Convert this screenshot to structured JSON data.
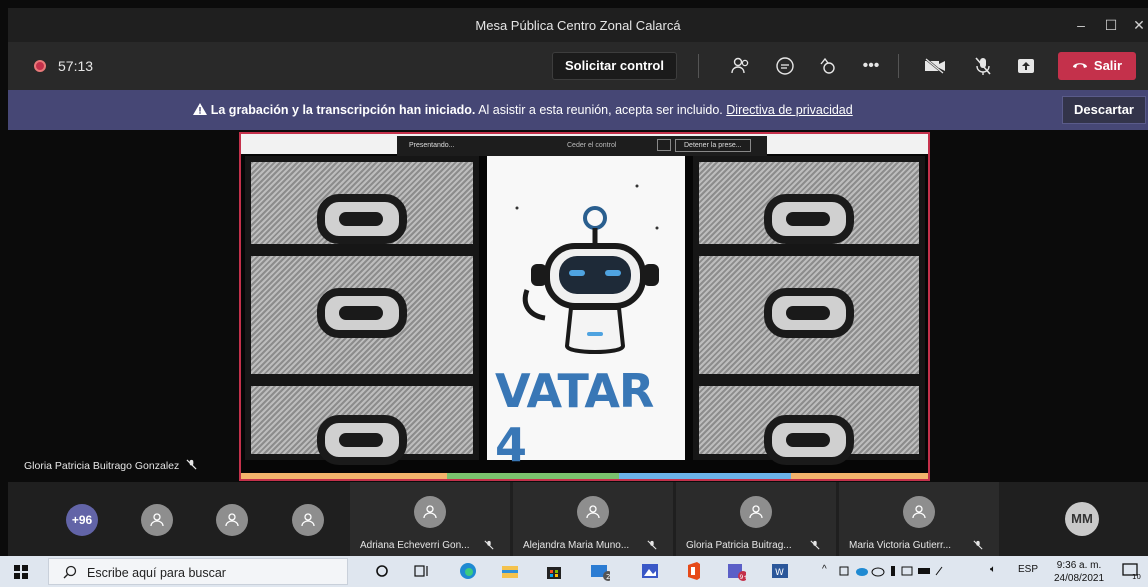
{
  "window": {
    "title": "Mesa Pública Centro Zonal Calarcá",
    "controls": [
      "minimize-icon",
      "maximize-icon",
      "close-icon"
    ]
  },
  "meeting_bar": {
    "timer": "57:13",
    "request_control_label": "Solicitar control",
    "icons": [
      "participants-icon",
      "chat-icon",
      "reactions-icon",
      "more-options-icon",
      "camera-off-icon",
      "mic-off-icon",
      "share-tray-icon"
    ],
    "leave_label": "Salir",
    "accent_leave": "#c4314b"
  },
  "banner": {
    "bold_text": "La grabación y la transcripción han iniciado.",
    "text": "Al asistir a esta reunión, acepta ser incluido.",
    "link": "Directiva de privacidad",
    "dismiss_label": "Descartar",
    "color": "#464775"
  },
  "shared_screen": {
    "presenting_label": "Presentando...",
    "give_control_label": "Ceder el control",
    "stop_presenting_label": "Detener la prese...",
    "logo_text": "VATAR 4",
    "border_color": "#c4314b"
  },
  "presenter": {
    "name": "Gloria Patricia Buitrago Gonzalez"
  },
  "participants": {
    "overflow_count": "+96",
    "tiles": [
      {
        "name": "Adriana Echeverri Gon..."
      },
      {
        "name": "Alejandra Maria Muno..."
      },
      {
        "name": "Gloria Patricia Buitrag..."
      },
      {
        "name": "Maria Victoria Gutierr..."
      }
    ],
    "initials": "MM"
  },
  "taskbar": {
    "search_placeholder": "Escribe aquí para buscar",
    "language": "ESP",
    "time": "9:36 a. m.",
    "date": "24/08/2021",
    "notification_count": "10",
    "badges": {
      "mail": "2",
      "teams": "9+"
    }
  }
}
